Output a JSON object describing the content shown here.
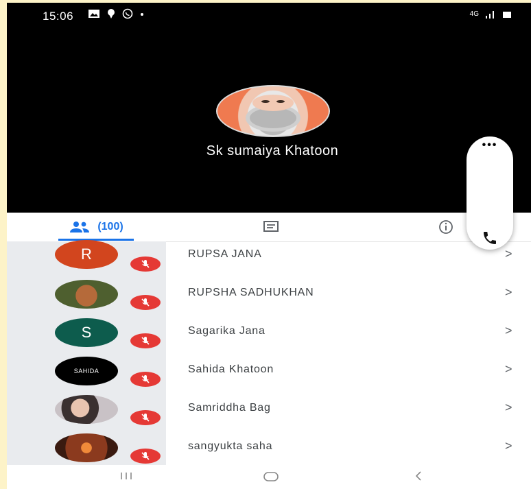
{
  "status_bar": {
    "time": "15:06",
    "network_label": "4G"
  },
  "call": {
    "caller_name": "Sk sumaiya Khatoon",
    "more_label": "•••"
  },
  "tabs": {
    "people_count": "(100)",
    "accent": "#1a73e8"
  },
  "participants": [
    {
      "name": "RUPSA JANA",
      "avatar_letter": "R",
      "avatar_color": "#d2451e",
      "muted": true
    },
    {
      "name": "RUPSHA SADHUKHAN",
      "avatar_letter": "",
      "avatar_color": "#5b6b3d",
      "muted": true
    },
    {
      "name": "Sagarika Jana",
      "avatar_letter": "S",
      "avatar_color": "#0d5c4d",
      "muted": true
    },
    {
      "name": "Sahida Khatoon",
      "avatar_letter": "SAHIDA",
      "avatar_color": "#000000",
      "muted": true
    },
    {
      "name": "Samriddha Bag",
      "avatar_letter": "",
      "avatar_color": "#8a7a7a",
      "muted": true
    },
    {
      "name": "sangyukta saha",
      "avatar_letter": "",
      "avatar_color": "#8b3a1e",
      "muted": true
    }
  ],
  "colors": {
    "mute_badge": "#e53935",
    "list_avatar_bg": "#e9ebee"
  }
}
